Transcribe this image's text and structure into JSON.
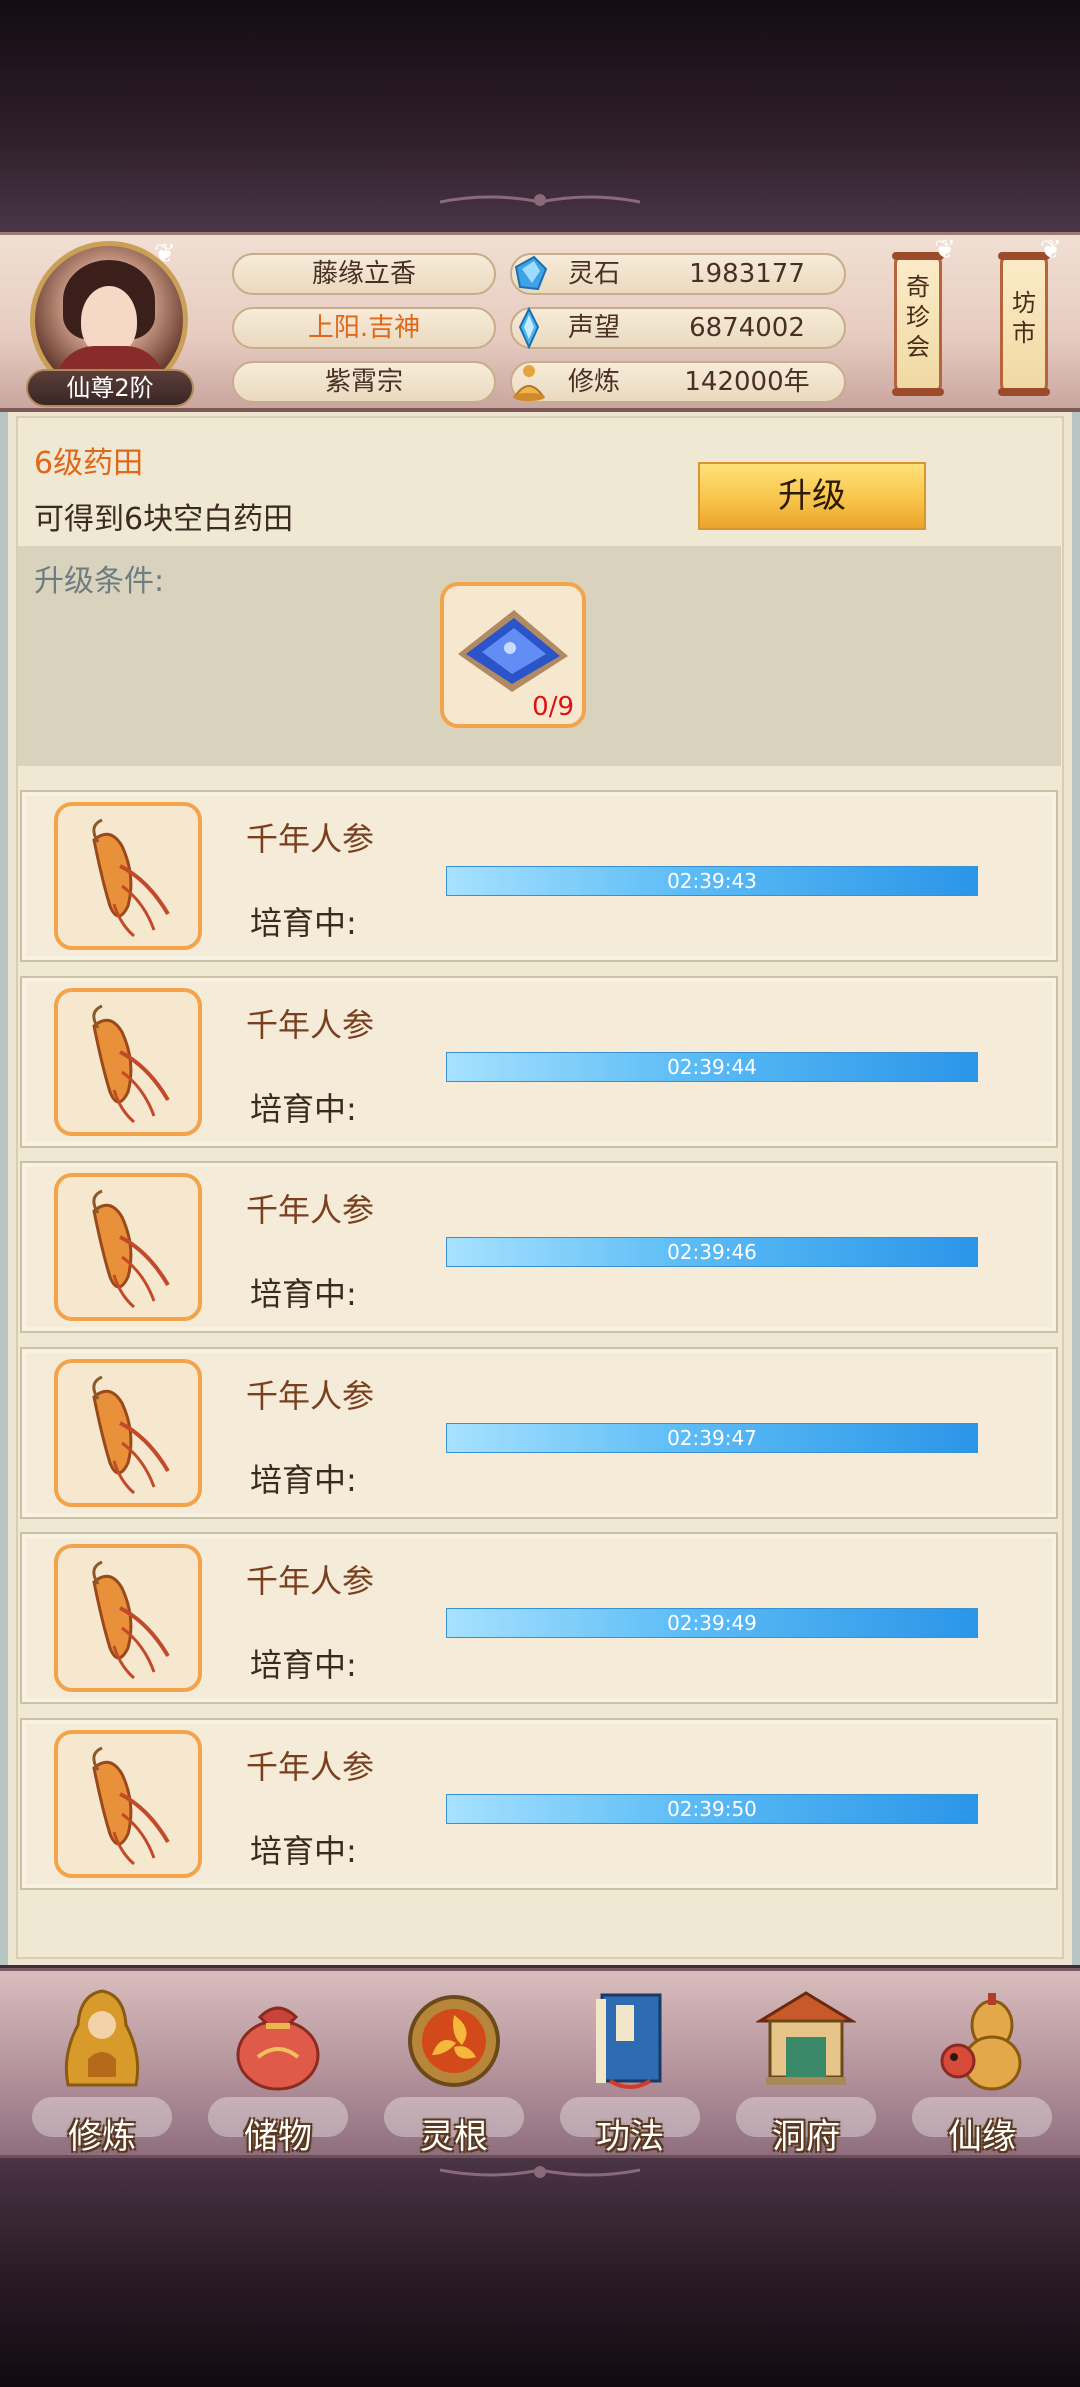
{
  "player": {
    "rank": "仙尊2阶",
    "name": "藤缘立香",
    "title": "上阳.吉神",
    "sect": "紫霄宗"
  },
  "resources": [
    {
      "label": "灵石",
      "value": "1983177",
      "icon": "spirit-stone-icon"
    },
    {
      "label": "声望",
      "value": "6874002",
      "icon": "prestige-crystal-icon"
    },
    {
      "label": "修炼",
      "value": "142000年",
      "icon": "meditation-icon"
    }
  ],
  "side_buttons": [
    {
      "label_chars": [
        "奇",
        "珍",
        "会"
      ]
    },
    {
      "label_chars": [
        "坊",
        "市"
      ]
    }
  ],
  "field": {
    "level_title": "6级药田",
    "description": "可得到6块空白药田",
    "upgrade_label": "升级",
    "condition_label": "升级条件:",
    "required_item_count": "0/9"
  },
  "herbs": [
    {
      "name": "千年人参",
      "status": "培育中:",
      "timer": "02:39:43"
    },
    {
      "name": "千年人参",
      "status": "培育中:",
      "timer": "02:39:44"
    },
    {
      "name": "千年人参",
      "status": "培育中:",
      "timer": "02:39:46"
    },
    {
      "name": "千年人参",
      "status": "培育中:",
      "timer": "02:39:47"
    },
    {
      "name": "千年人参",
      "status": "培育中:",
      "timer": "02:39:49"
    },
    {
      "name": "千年人参",
      "status": "培育中:",
      "timer": "02:39:50"
    }
  ],
  "nav": [
    {
      "label": "修炼",
      "icon": "cultivation-monk-icon"
    },
    {
      "label": "储物",
      "icon": "storage-bag-icon"
    },
    {
      "label": "灵根",
      "icon": "spirit-root-icon"
    },
    {
      "label": "功法",
      "icon": "technique-book-icon"
    },
    {
      "label": "洞府",
      "icon": "cave-mansion-icon"
    },
    {
      "label": "仙缘",
      "icon": "immortal-fate-icon"
    }
  ],
  "colors": {
    "accent_orange": "#e0661a",
    "progress_blue": "#2b95e8",
    "count_red": "#e01010"
  }
}
